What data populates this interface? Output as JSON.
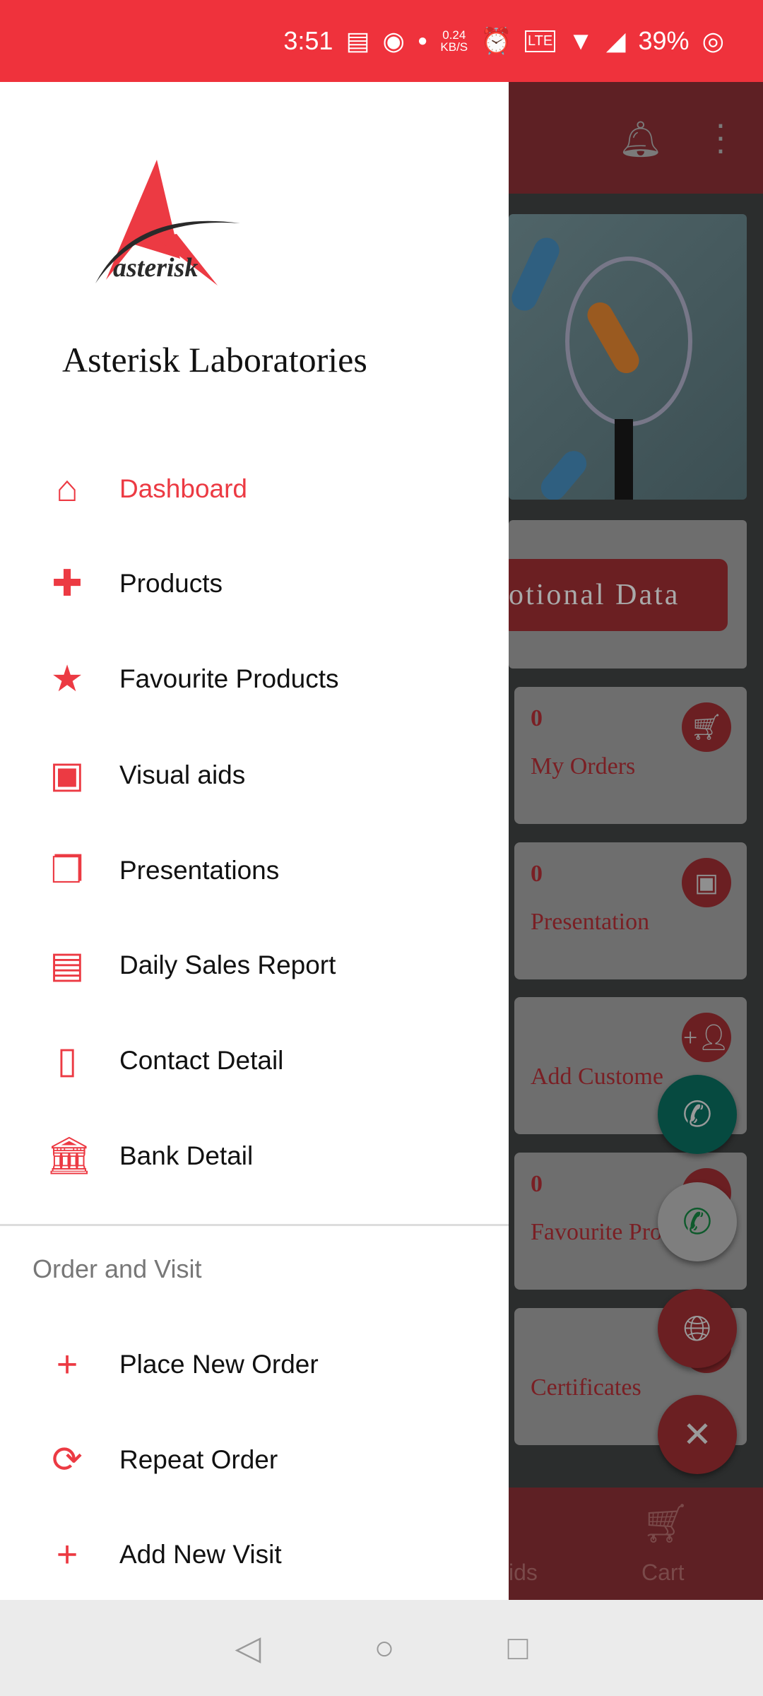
{
  "status_bar": {
    "time": "3:51",
    "net_speed": "0.24",
    "net_unit": "KB/S",
    "battery": "39%"
  },
  "colors": {
    "accent": "#ec3a43",
    "status_bar": "#ef323c"
  },
  "drawer": {
    "brand": "Asterisk Laboratories",
    "logo_text": "asterisk",
    "items": [
      {
        "label": "Dashboard",
        "icon": "home-icon",
        "active": true
      },
      {
        "label": "Products",
        "icon": "medical-plus-icon"
      },
      {
        "label": "Favourite Products",
        "icon": "star-icon"
      },
      {
        "label": "Visual aids",
        "icon": "image-icon"
      },
      {
        "label": "Presentations",
        "icon": "photo-library-icon"
      },
      {
        "label": "Daily Sales Report",
        "icon": "clipboard-icon"
      },
      {
        "label": "Contact Detail",
        "icon": "phone-device-icon"
      },
      {
        "label": "Bank Detail",
        "icon": "bank-icon"
      }
    ],
    "section_title": "Order and Visit",
    "section_items": [
      {
        "label": "Place New Order",
        "icon": "plus-icon"
      },
      {
        "label": "Repeat Order",
        "icon": "repeat-icon"
      },
      {
        "label": "Add New Visit",
        "icon": "plus-icon"
      }
    ]
  },
  "background": {
    "promo_button": "otional Data",
    "cards": [
      {
        "count": "0",
        "label": "My Orders",
        "icon": "cart-icon"
      },
      {
        "count": "0",
        "label": "Presentation",
        "icon": "photo-library-icon"
      },
      {
        "count": "",
        "label": "Add Custome",
        "icon": "add-person-icon"
      },
      {
        "count": "0",
        "label": "Favourite Pro",
        "icon": "star-icon"
      },
      {
        "count": "",
        "label": "Certificates",
        "icon": "certificate-icon"
      }
    ],
    "bottom_nav": {
      "partial": "ids",
      "cart": "Cart"
    }
  }
}
